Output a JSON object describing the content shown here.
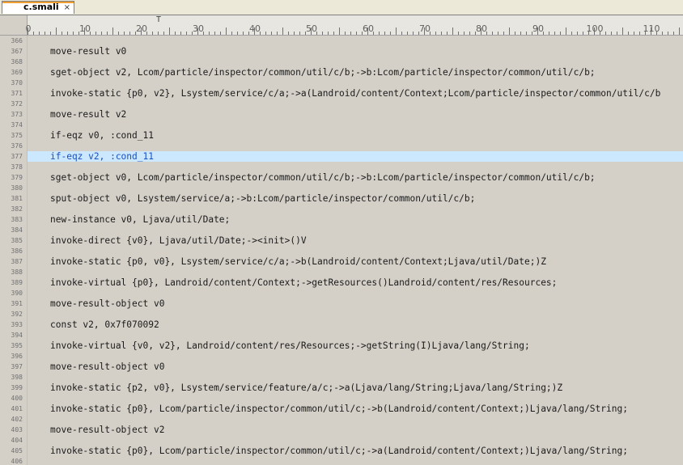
{
  "tab": {
    "title": "c.smali",
    "close_glyph": "×"
  },
  "ruler": {
    "labels": [
      "0",
      "10",
      "20",
      "30",
      "40",
      "50",
      "60",
      "70",
      "80",
      "90",
      "100",
      "110"
    ],
    "caret_glyph": "T"
  },
  "editor": {
    "line_numbers": [
      "366",
      "367",
      "368",
      "369",
      "370",
      "371",
      "372",
      "373",
      "374",
      "375",
      "376",
      "377",
      "378",
      "379",
      "380",
      "381",
      "382",
      "383",
      "384",
      "385",
      "386",
      "387",
      "388",
      "389",
      "390",
      "391",
      "392",
      "393",
      "394",
      "395",
      "396",
      "397",
      "398",
      "399",
      "400",
      "401",
      "402",
      "403",
      "404",
      "405",
      "406"
    ],
    "current_line": "377",
    "code": [
      {
        "num": "367",
        "text": "move-result v0"
      },
      {
        "num": "369",
        "text": "sget-object v2, Lcom/particle/inspector/common/util/c/b;->b:Lcom/particle/inspector/common/util/c/b;"
      },
      {
        "num": "371",
        "text": "invoke-static {p0, v2}, Lsystem/service/c/a;->a(Landroid/content/Context;Lcom/particle/inspector/common/util/c/b"
      },
      {
        "num": "373",
        "text": "move-result v2"
      },
      {
        "num": "375",
        "text": "if-eqz v0, :cond_11"
      },
      {
        "num": "377",
        "text": "if-eqz v2, :cond_11"
      },
      {
        "num": "379",
        "text": "sget-object v0, Lcom/particle/inspector/common/util/c/b;->b:Lcom/particle/inspector/common/util/c/b;"
      },
      {
        "num": "381",
        "text": "sput-object v0, Lsystem/service/a;->b:Lcom/particle/inspector/common/util/c/b;"
      },
      {
        "num": "383",
        "text": "new-instance v0, Ljava/util/Date;"
      },
      {
        "num": "385",
        "text": "invoke-direct {v0}, Ljava/util/Date;-><init>()V"
      },
      {
        "num": "387",
        "text": "invoke-static {p0, v0}, Lsystem/service/c/a;->b(Landroid/content/Context;Ljava/util/Date;)Z"
      },
      {
        "num": "389",
        "text": "invoke-virtual {p0}, Landroid/content/Context;->getResources()Landroid/content/res/Resources;"
      },
      {
        "num": "391",
        "text": "move-result-object v0"
      },
      {
        "num": "393",
        "text": "const v2, 0x7f070092"
      },
      {
        "num": "395",
        "text": "invoke-virtual {v0, v2}, Landroid/content/res/Resources;->getString(I)Ljava/lang/String;"
      },
      {
        "num": "397",
        "text": "move-result-object v0"
      },
      {
        "num": "399",
        "text": "invoke-static {p2, v0}, Lsystem/service/feature/a/c;->a(Ljava/lang/String;Ljava/lang/String;)Z"
      },
      {
        "num": "401",
        "text": "invoke-static {p0}, Lcom/particle/inspector/common/util/c;->b(Landroid/content/Context;)Ljava/lang/String;"
      },
      {
        "num": "403",
        "text": "move-result-object v2"
      },
      {
        "num": "405",
        "text": "invoke-static {p0}, Lcom/particle/inspector/common/util/c;->a(Landroid/content/Context;)Ljava/lang/String;"
      }
    ]
  }
}
